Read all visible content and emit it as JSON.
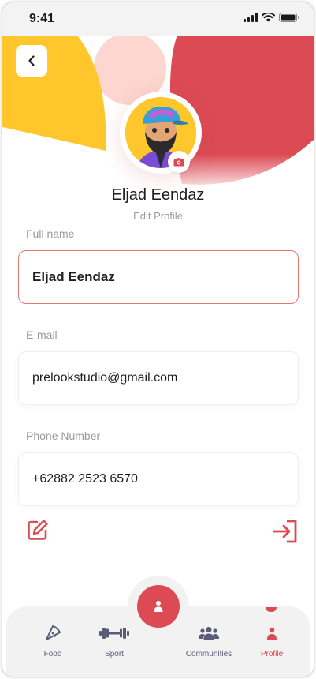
{
  "status_bar": {
    "time": "9:41"
  },
  "profile": {
    "name": "Eljad Eendaz",
    "edit_label": "Edit Profile"
  },
  "form": {
    "full_name": {
      "label": "Full name",
      "value": "Eljad Eendaz"
    },
    "email": {
      "label": "E-mail",
      "value": "prelookstudio@gmail.com"
    },
    "phone": {
      "label": "Phone Number",
      "value": "+62882 2523 6570"
    }
  },
  "bottom_nav": {
    "items": [
      {
        "label": "Food",
        "icon": "pizza-slice-icon"
      },
      {
        "label": "Sport",
        "icon": "dumbbell-icon"
      },
      {
        "label": "Communities",
        "icon": "people-group-icon"
      },
      {
        "label": "Profile",
        "icon": "user-icon",
        "active": true
      }
    ],
    "center_icon": "user-icon"
  },
  "colors": {
    "accent_red": "#dc4a53",
    "hero_yellow": "#ffc72c",
    "hero_pink": "#fcd6cf",
    "field_active_border": "#e9766a",
    "nav_background": "#f2f2f2"
  }
}
